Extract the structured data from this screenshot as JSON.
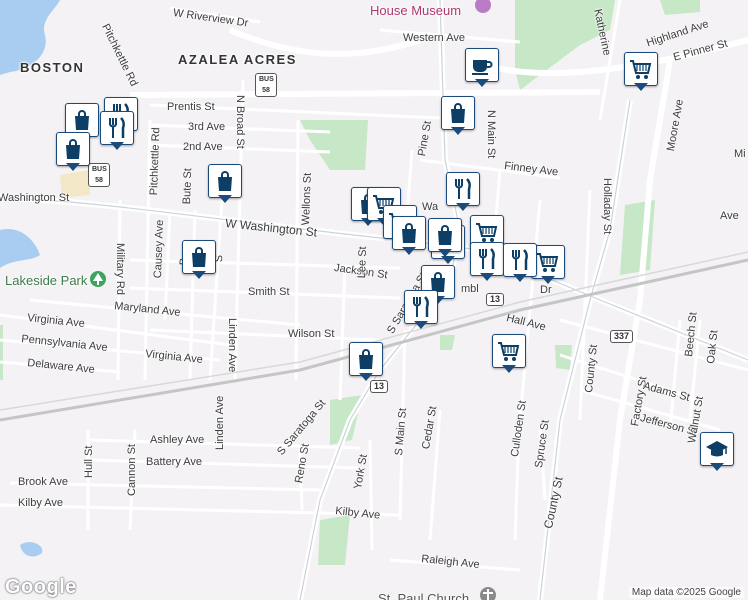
{
  "map": {
    "attribution": "Map data ©2025 Google",
    "logo": "Google",
    "areas": [
      "BOSTON",
      "AZALEA ACRES"
    ],
    "poi_names": [
      "House Museum",
      "Lakeside Park",
      "St. Paul Church"
    ],
    "streets": [
      "W Riverview Dr",
      "Western Ave",
      "Highland Ave",
      "Katherine",
      "E Pinner St",
      "Pitchkettle Rd",
      "Prentis St",
      "3rd Ave",
      "2nd Ave",
      "N Broad St",
      "Washington St",
      "W Washington St",
      "Finney Ave",
      "Pine St",
      "N Main St",
      "Holladay St",
      "Moore Ave",
      "Pitchkettle Rd",
      "Bute St",
      "Causey Ave",
      "Military Rd",
      "Jackson St",
      "Smith St",
      "Maryland Ave",
      "Wellons St",
      "Linden Ave",
      "Lee St",
      "Virginia Ave",
      "Virginia Ave",
      "Pennsylvania Ave",
      "Delaware Ave",
      "Wilson St",
      "S Saratoga St",
      "Hall Ave",
      "County St",
      "Beech St",
      "Oak St",
      "Factory St",
      "Adams St",
      "Jefferson St",
      "Walnut St",
      "S Saratoga St",
      "Reno St",
      "York St",
      "S Main St",
      "Cedar St",
      "Culloden St",
      "Spruce St",
      "Ashley Ave",
      "Battery Ave",
      "Cannon St",
      "Hull St",
      "Linden Ave",
      "Brook Ave",
      "Kilby Ave",
      "Kilby Ave",
      "County St",
      "Raleigh Ave",
      "Ave",
      "Mi",
      "B",
      "S",
      "Wa",
      "mbl",
      "Dr"
    ],
    "route_shields": [
      "BUS 58",
      "BUS 58",
      "13",
      "13",
      "337"
    ],
    "pins": [
      "cafe",
      "shopping",
      "restaurant",
      "shopping",
      "restaurant",
      "shopping",
      "shopping",
      "shopping",
      "shopping",
      "grocery",
      "grocery",
      "shopping",
      "grocery",
      "shopping",
      "grocery",
      "restaurant",
      "restaurant",
      "grocery",
      "shopping",
      "restaurant",
      "shopping",
      "grocery",
      "school",
      "grocery",
      "restaurant"
    ]
  }
}
